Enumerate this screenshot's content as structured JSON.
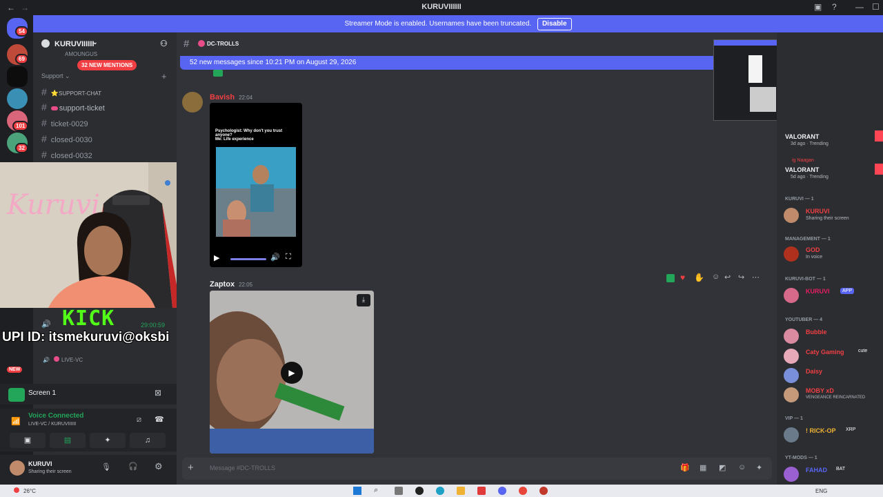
{
  "window": {
    "title": "KURUVIIIIII",
    "back": "←",
    "forward": "→"
  },
  "banner": {
    "text": "Streamer Mode is enabled. Usernames have been truncated.",
    "disable_label": "Disable"
  },
  "guild_badges": [
    "54",
    "69",
    "101",
    "32",
    "NEW"
  ],
  "server": {
    "name": "KURUVIIIIII",
    "partial_channel": "AMOUNGUS",
    "mentions_label": "32 NEW MENTIONS",
    "category": "Support"
  },
  "channels": [
    "SUPPORT-CHAT",
    "support-ticket",
    "ticket-0029",
    "closed-0030",
    "closed-0032"
  ],
  "voice_channel": "LIVE-VC",
  "overlay": {
    "kick": "KICK",
    "upi": "UPI ID: itsmekuruvi@oksbi",
    "timer": "29:00:59"
  },
  "stream_panel": {
    "label": "Screen 1"
  },
  "voice_panel": {
    "status": "Voice Connected",
    "location": "LIVE-VC / KURUVIIIIII"
  },
  "user_panel": {
    "name": "KURUVI",
    "status": "Sharing their screen"
  },
  "chat": {
    "channel_name": "DC-TROLLS",
    "new_messages": "52 new messages since 10:21 PM on August 29, 2026",
    "msg1": {
      "author": "Bavish",
      "time": "22:04",
      "meme_caption": "Psychologist: Why don't you trust anyone?\nMe: Life experience"
    },
    "msg2": {
      "author": "Zaptox",
      "time": "22:05"
    },
    "input_placeholder": "Message #DC-TROLLS"
  },
  "members": {
    "activity1": {
      "game": "VALORANT",
      "meta": "3d ago  ·  Trending"
    },
    "activity2": {
      "user": "ig Naagan",
      "game": "VALORANT",
      "meta": "5d ago  ·  Trending"
    },
    "groups": [
      {
        "header": "KURUVI — 1",
        "members": [
          {
            "name": "KURUVI",
            "sub": "Sharing their screen",
            "color": "#f23f43"
          }
        ]
      },
      {
        "header": "MANAGEMENT — 1",
        "members": [
          {
            "name": "GOD",
            "sub": "In voice",
            "color": "#f23f43"
          }
        ]
      },
      {
        "header": "KURUVI-BOT — 1",
        "members": [
          {
            "name": "KURUVI",
            "sub": "",
            "tag": "APP",
            "color": "#e91e63"
          }
        ]
      },
      {
        "header": "YOUTUBER — 4",
        "members": [
          {
            "name": "Bubble",
            "sub": "",
            "color": "#f23f43"
          },
          {
            "name": "Caty Gaming",
            "sub": "",
            "tag": "cute",
            "color": "#f23f43"
          },
          {
            "name": "Daisy",
            "sub": "",
            "color": "#f23f43"
          },
          {
            "name": "MOBY xD",
            "sub": "VENGEANCE REINCARNATED",
            "color": "#f23f43"
          }
        ]
      },
      {
        "header": "VIP — 1",
        "members": [
          {
            "name": "! RICK-OP",
            "sub": "",
            "tag": "XRP",
            "color": "#f0b232"
          }
        ]
      },
      {
        "header": "YT-MODS — 1",
        "members": [
          {
            "name": "FAHAD",
            "sub": "",
            "tag": "BAT",
            "color": "#5865f2"
          }
        ]
      }
    ]
  },
  "taskbar": {
    "weather": "26°C",
    "lang": "ENG"
  },
  "colors": {
    "blurple": "#5865f2",
    "green": "#23a55a",
    "red": "#f23f43",
    "kick": "#53fc18"
  }
}
